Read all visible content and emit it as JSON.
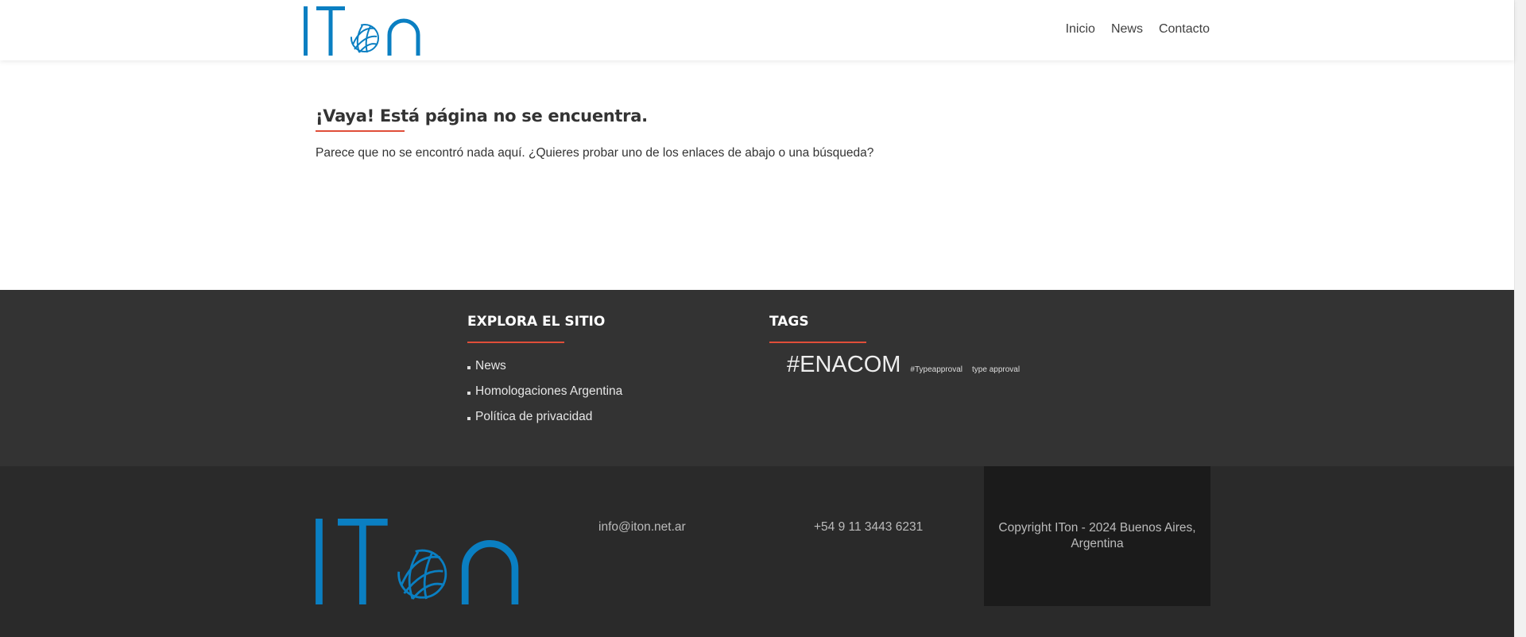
{
  "brand": {
    "logo_text": "ITon",
    "accent_color": "#0a7fc2",
    "underline_color": "#e04e39"
  },
  "nav": {
    "items": [
      "Inicio",
      "News",
      "Contacto"
    ]
  },
  "error": {
    "title": "¡Vaya! Está página no se encuentra.",
    "message": "Parece que no se encontró nada aquí. ¿Quieres probar uno de los enlaces de abajo o una búsqueda?"
  },
  "widgets": {
    "explore": {
      "title": "EXPLORA EL SITIO",
      "links": [
        "News",
        "Homologaciones Argentina",
        "Política de privacidad"
      ]
    },
    "tags": {
      "title": "TAGS",
      "items": [
        "#ENACOM",
        "#Typeapproval",
        "type approval"
      ]
    }
  },
  "footer": {
    "email": "info@iton.net.ar",
    "phone": "+54 9 11 3443 6231",
    "copyright": "Copyright ITon - 2024 Buenos Aires, Argentina"
  }
}
